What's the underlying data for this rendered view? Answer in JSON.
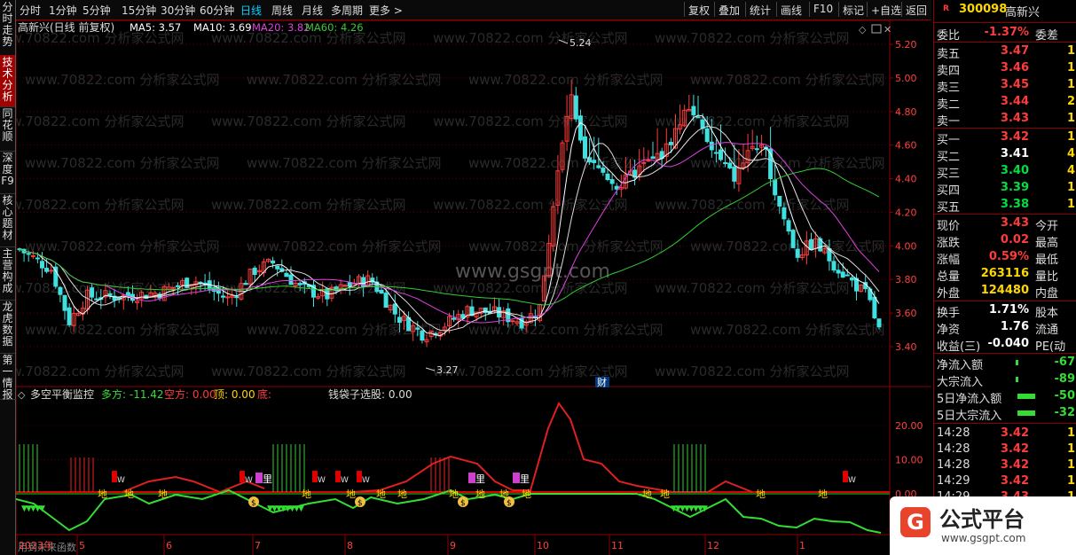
{
  "sidebar": {
    "items": [
      {
        "label": "分时走势",
        "active": false
      },
      {
        "label": "技术分析",
        "active": true
      },
      {
        "label": "同花顺",
        "active": false
      },
      {
        "label": "深度F9",
        "active": false
      },
      {
        "label": "核心题材",
        "active": false
      },
      {
        "label": "主营构成",
        "active": false
      },
      {
        "label": "龙虎数据",
        "active": false
      },
      {
        "label": "第一情报",
        "active": false
      }
    ]
  },
  "toolbar": {
    "periods": [
      "分时",
      "1分钟",
      "5分钟",
      "15分钟",
      "30分钟",
      "60分钟",
      "日线",
      "周线",
      "月线",
      "多周期",
      "更多 >"
    ],
    "active_period": "日线",
    "tools": [
      "复权",
      "叠加",
      "统计",
      "画线",
      "F10",
      "标记",
      "+自选",
      "返回"
    ]
  },
  "main_chart": {
    "legend_name": "高新兴(日线 前复权)",
    "ma": [
      {
        "label": "MA5: 3.57",
        "color": "#ffffff"
      },
      {
        "label": "MA10: 3.69",
        "color": "#ffffff"
      },
      {
        "label": "MA20: 3.82",
        "color": "#e040e0"
      },
      {
        "label": "MA60: 4.26",
        "color": "#33cc33"
      }
    ],
    "y_ticks": [
      "5.20",
      "5.00",
      "4.80",
      "4.60",
      "4.40",
      "4.20",
      "4.00",
      "3.80",
      "3.60",
      "3.40"
    ],
    "high_label": "5.24",
    "low_label": "3.27",
    "event_label": "财",
    "watermark_site": "www.gsgpt.com",
    "watermark_repeat": "www.70822.com 分析家公式网"
  },
  "indicator": {
    "name": "多空平衡监控",
    "duofang": "多方: -11.42",
    "kongfang": "空方: 0.00",
    "ding": "顶: 0.00",
    "di": "底:",
    "qiandai": "钱袋子选股: 0.00",
    "y_ticks": [
      "20.00",
      "10.00",
      "0.00"
    ],
    "marker_li": "里",
    "marker_di": "地",
    "marker_w": "W",
    "future_note": "用到未来函数"
  },
  "x_axis": {
    "labels": [
      "2023年",
      "5",
      "6",
      "7",
      "8",
      "9",
      "10",
      "11",
      "12",
      "1"
    ]
  },
  "right_panel": {
    "code": "300098",
    "name": "高新兴",
    "weibi_label": "委比",
    "weibi_val": "-1.37%",
    "weicha_label": "委差",
    "asks": [
      {
        "label": "卖五",
        "price": "3.47",
        "vol": "1"
      },
      {
        "label": "卖四",
        "price": "3.46",
        "vol": "1"
      },
      {
        "label": "卖三",
        "price": "3.45",
        "vol": "1"
      },
      {
        "label": "卖二",
        "price": "3.44",
        "vol": "2"
      },
      {
        "label": "卖一",
        "price": "3.43",
        "vol": "1"
      }
    ],
    "bids": [
      {
        "label": "买一",
        "price": "3.42",
        "vol": "1"
      },
      {
        "label": "买二",
        "price": "3.41",
        "vol": "4"
      },
      {
        "label": "买三",
        "price": "3.40",
        "vol": "4"
      },
      {
        "label": "买四",
        "price": "3.39",
        "vol": "1"
      },
      {
        "label": "买五",
        "price": "3.38",
        "vol": "1"
      }
    ],
    "stats": [
      {
        "label": "现价",
        "val": "3.43",
        "extra": "今开",
        "color": "red"
      },
      {
        "label": "涨跌",
        "val": "0.02",
        "extra": "最高",
        "color": "red"
      },
      {
        "label": "涨幅",
        "val": "0.59%",
        "extra": "最低",
        "color": "red"
      },
      {
        "label": "总量",
        "val": "263116",
        "extra": "量比",
        "color": "yellow"
      },
      {
        "label": "外盘",
        "val": "124480",
        "extra": "内盘",
        "color": "yellow"
      }
    ],
    "stats2": [
      {
        "label": "换手",
        "val": "1.71%",
        "extra": "股本",
        "color": "white"
      },
      {
        "label": "净资",
        "val": "1.76",
        "extra": "流通",
        "color": "white"
      },
      {
        "label": "收益(三)",
        "val": "-0.040",
        "extra": "PE(动",
        "color": "white"
      }
    ],
    "flows": [
      {
        "label": "净流入额",
        "val": "-67"
      },
      {
        "label": "大宗流入",
        "val": "-89"
      },
      {
        "label": "5日净流入额",
        "val": "-50"
      },
      {
        "label": "5日大宗流入",
        "val": "-32"
      }
    ],
    "ticks": [
      {
        "time": "14:28",
        "price": "3.42",
        "vol": "1"
      },
      {
        "time": "14:28",
        "price": "3.42",
        "vol": "1"
      },
      {
        "time": "14:28",
        "price": "3.42",
        "vol": "1"
      },
      {
        "time": "14:29",
        "price": "3.42",
        "vol": "1"
      },
      {
        "time": "14:29",
        "price": "3.43",
        "vol": "1"
      }
    ],
    "brand": "公式平台",
    "brand_url": "www.gsgpt.com"
  },
  "colors": {
    "up": "#ff3b3b",
    "down": "#40e0e0",
    "ma5": "#ffffff",
    "ma20": "#e040e0",
    "ma60": "#33cc33",
    "panel_border": "#8b0000"
  }
}
